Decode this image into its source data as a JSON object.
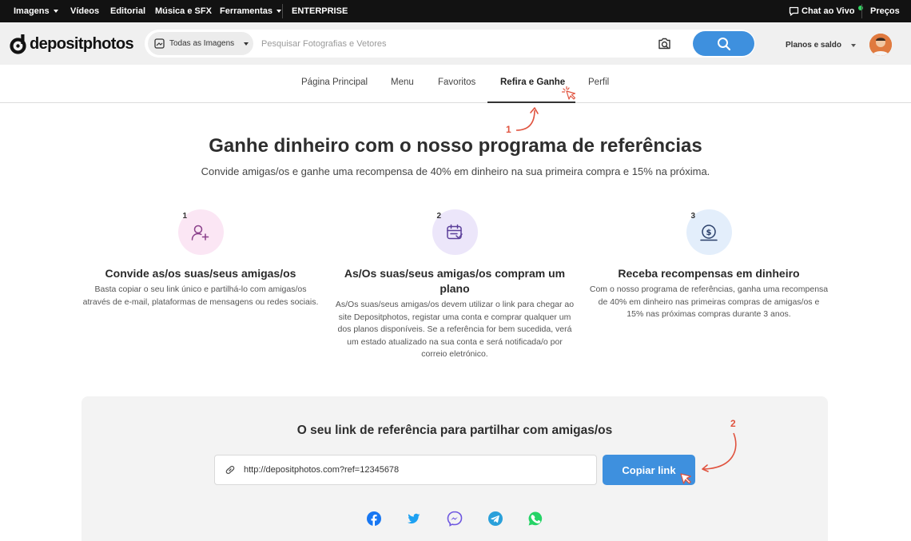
{
  "topbar": {
    "nav": [
      "Imagens",
      "Vídeos",
      "Editorial",
      "Música e SFX",
      "Ferramentas",
      "ENTERPRISE"
    ],
    "chat": "Chat ao Vivo",
    "prices": "Preços"
  },
  "header": {
    "logo": "depositphotos",
    "search_type": "Todas as Imagens",
    "search_placeholder": "Pesquisar Fotografias e Vetores",
    "plans": "Planos e saldo"
  },
  "tabs": [
    "Página Principal",
    "Menu",
    "Favoritos",
    "Refira e Ganhe",
    "Perfil"
  ],
  "active_tab": "Refira e Ganhe",
  "annotations": [
    "1",
    "2"
  ],
  "hero": {
    "title": "Ganhe dinheiro com o nosso programa de referências",
    "subtitle": "Convide amigas/os e ganhe uma recompensa de 40% em dinheiro na sua primeira compra e 15% na próxima."
  },
  "steps": [
    {
      "num": "1",
      "icon": "add-user-icon",
      "title": "Convide as/os suas/seus amigas/os",
      "desc": "Basta copiar o seu link único e partilhá-lo com amigas/os através de e-mail, plataformas de mensagens ou redes sociais."
    },
    {
      "num": "2",
      "icon": "calendar-icon",
      "title": "As/Os suas/seus amigas/os compram um plano",
      "desc": "As/Os suas/seus amigas/os devem utilizar o link para chegar ao site Depositphotos, registar uma conta e comprar qualquer um dos planos disponíveis. Se a referência for bem sucedida, verá um estado atualizado na sua conta e será notificada/o por correio eletrónico."
    },
    {
      "num": "3",
      "icon": "money-bag-icon",
      "title": "Receba recompensas em dinheiro",
      "desc": "Com o nosso programa de referências, ganha uma recompensa de 40% em dinheiro nas primeiras compras de amigas/os e 15% nas próximas compras durante 3 anos."
    }
  ],
  "referral": {
    "title": "O seu link de referência para partilhar com amigas/os",
    "link": "http://depositphotos.com?ref=12345678",
    "copy_label": "Copiar link"
  },
  "social": [
    "facebook-icon",
    "twitter-icon",
    "messenger-icon",
    "telegram-icon",
    "whatsapp-icon"
  ],
  "colors": {
    "accent": "#3e90de",
    "annotation": "#e0533f",
    "topbar": "#121212"
  }
}
